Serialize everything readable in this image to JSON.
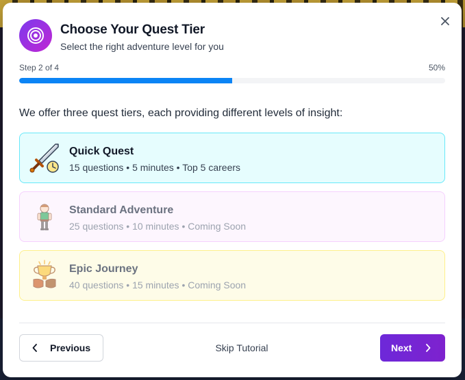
{
  "modal": {
    "title": "Choose Your Quest Tier",
    "subtitle": "Select the right adventure level for you",
    "logo_icon": "target-icon",
    "close_icon": "close-icon"
  },
  "progress": {
    "step_label": "Step 2 of 4",
    "percent_label": "50%",
    "fraction": 0.5
  },
  "intro": "We offer three quest tiers, each providing different levels of insight:",
  "tiers": [
    {
      "name": "Quick Quest",
      "meta": "15 questions • 5 minutes • Top 5 careers",
      "icon": "sword-clock-icon",
      "state": "selected"
    },
    {
      "name": "Standard Adventure",
      "meta": "25 questions • 10 minutes • Coming Soon",
      "icon": "adventurer-icon",
      "state": "disabled"
    },
    {
      "name": "Epic Journey",
      "meta": "40 questions • 15 minutes • Coming Soon",
      "icon": "trophy-icon",
      "state": "disabled"
    }
  ],
  "footer": {
    "previous_label": "Previous",
    "skip_label": "Skip Tutorial",
    "next_label": "Next"
  },
  "colors": {
    "accent": "#6d28d9",
    "progress": "#0b84f5",
    "quick_bg": "#e6fdfe",
    "standard_bg": "#fdf6fe",
    "epic_bg": "#fefce8"
  }
}
